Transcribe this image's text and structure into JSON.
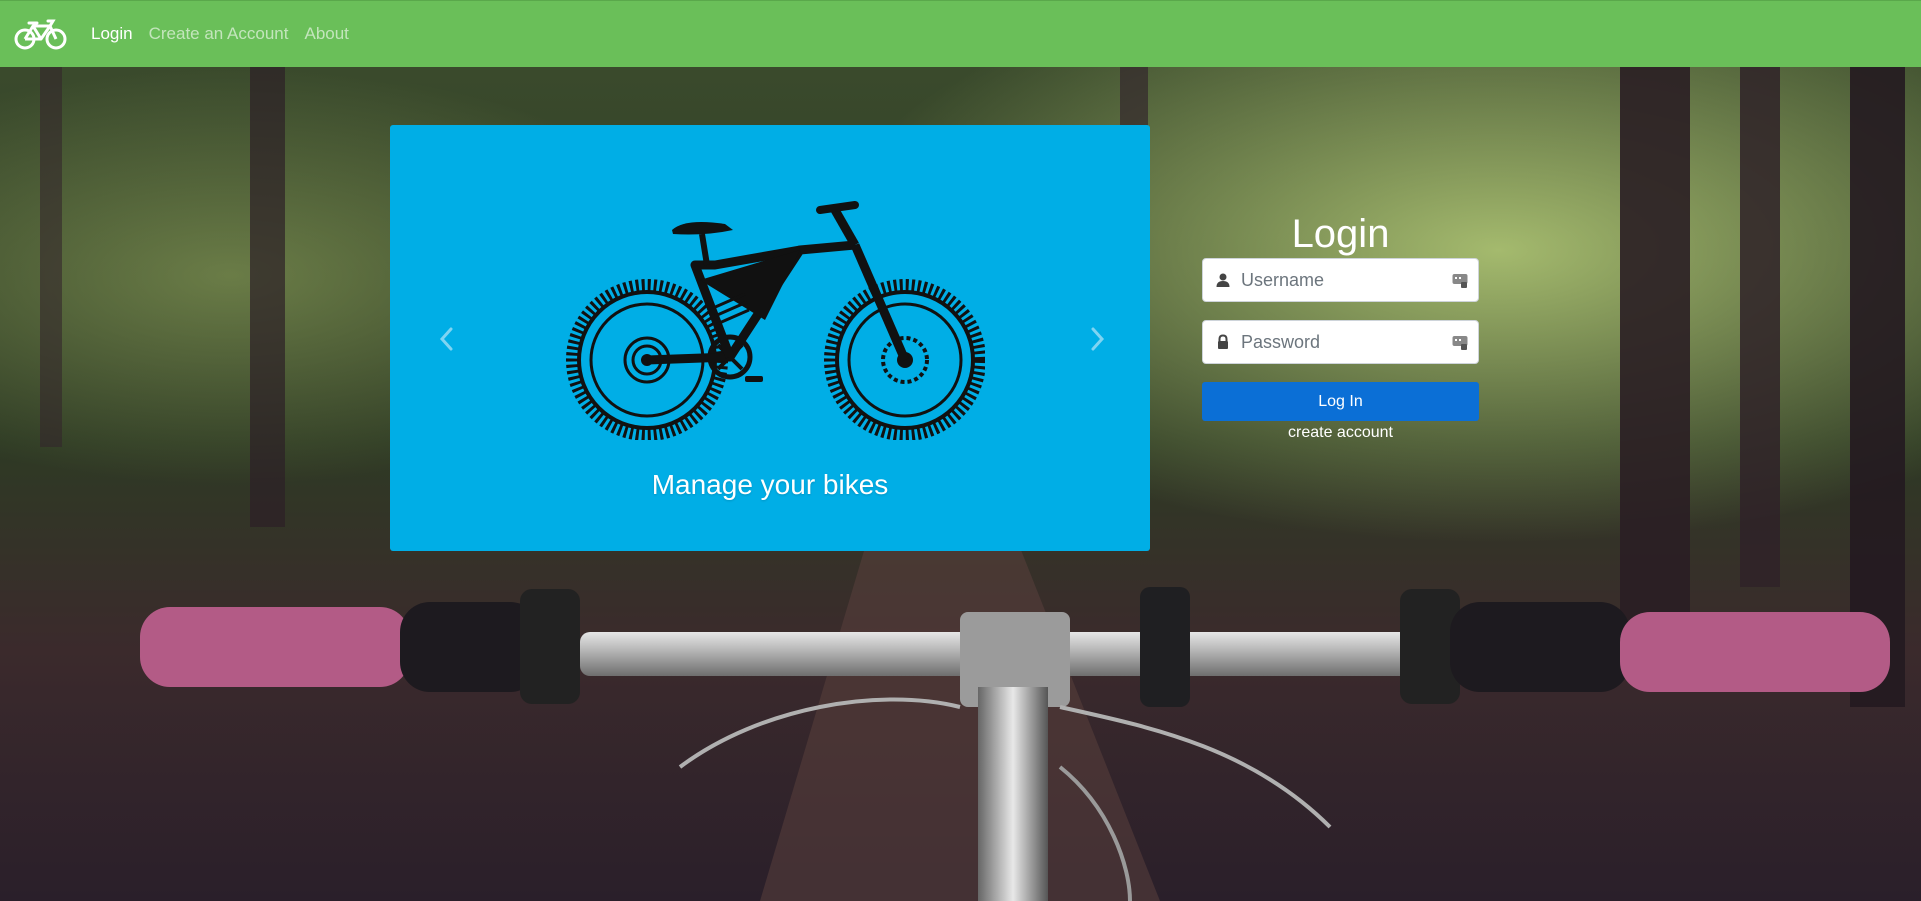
{
  "navbar": {
    "brand_icon": "bicycle-icon",
    "links": [
      {
        "label": "Login",
        "active": true
      },
      {
        "label": "Create an Account",
        "active": false
      },
      {
        "label": "About",
        "active": false
      }
    ],
    "color": "#6abf59"
  },
  "carousel": {
    "caption": "Manage your bikes",
    "background": "#00aee6",
    "image_icon": "mountain-bike-icon",
    "prev_icon": "chevron-left-icon",
    "next_icon": "chevron-right-icon"
  },
  "login": {
    "title": "Login",
    "username_placeholder": "Username",
    "password_placeholder": "Password",
    "submit_label": "Log In",
    "create_account_label": "create account",
    "button_color": "#0b6fd6"
  }
}
